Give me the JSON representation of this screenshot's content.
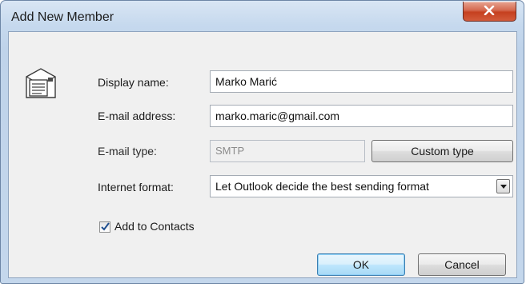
{
  "window": {
    "title": "Add New Member"
  },
  "icons": {
    "close": "close-icon",
    "contact_card": "contact-card-icon",
    "dropdown": "chevron-down-icon",
    "check": "check-icon"
  },
  "form": {
    "display_name": {
      "label": "Display name:",
      "value": "Marko Marić"
    },
    "email_address": {
      "label": "E-mail address:",
      "value": "marko.maric@gmail.com"
    },
    "email_type": {
      "label": "E-mail type:",
      "value": "SMTP",
      "custom_type_button": "Custom type"
    },
    "internet_format": {
      "label": "Internet format:",
      "selected": "Let Outlook decide the best sending format"
    },
    "add_to_contacts": {
      "label": "Add to Contacts",
      "checked": true
    }
  },
  "buttons": {
    "ok": "OK",
    "cancel": "Cancel"
  },
  "colors": {
    "title_gradient_top": "#d9e6f4",
    "client_bg": "#f0f0f0",
    "close_red": "#c5401f",
    "default_button_blue": "#3c7fb1"
  }
}
